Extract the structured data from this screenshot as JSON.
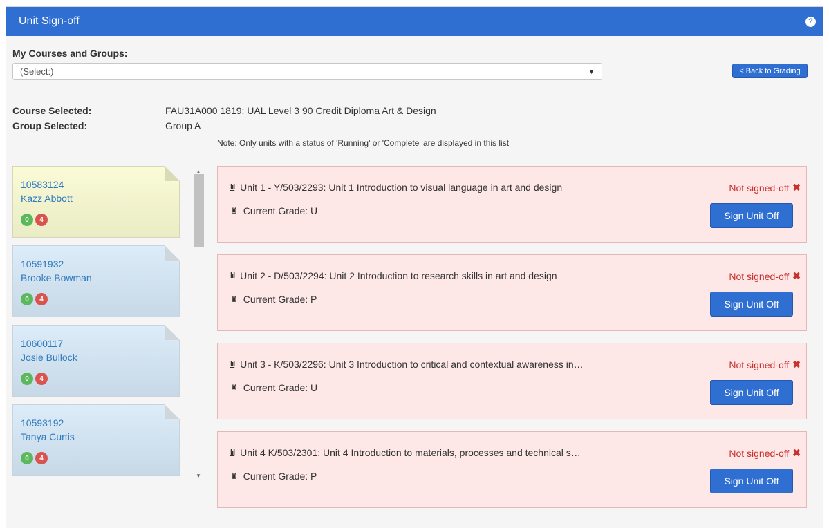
{
  "header": {
    "title": "Unit Sign-off",
    "help_icon": "?"
  },
  "courses": {
    "label": "My Courses and Groups:",
    "select_value": "(Select:)",
    "back_button": "< Back to Grading"
  },
  "selection": {
    "course_label": "Course Selected:",
    "course_value": "FAU31A000 1819: UAL Level 3 90 Credit Diploma Art & Design",
    "group_label": "Group Selected:",
    "group_value": "Group A"
  },
  "note": "Note: Only units with a status of 'Running' or 'Complete' are displayed in this list",
  "students": [
    {
      "id": "10583124",
      "name": "Kazz Abbott",
      "green": "0",
      "red": "4",
      "active": true
    },
    {
      "id": "10591932",
      "name": "Brooke Bowman",
      "green": "0",
      "red": "4",
      "active": false
    },
    {
      "id": "10600117",
      "name": "Josie Bullock",
      "green": "0",
      "red": "4",
      "active": false
    },
    {
      "id": "10593192",
      "name": "Tanya Curtis",
      "green": "0",
      "red": "4",
      "active": false
    }
  ],
  "units": [
    {
      "title": "Unit 1 - Y/503/2293: Unit 1 Introduction to visual language in art and design",
      "grade": "Current Grade: U",
      "status": "Not signed-off",
      "button": "Sign Unit Off"
    },
    {
      "title": "Unit 2 - D/503/2294: Unit 2 Introduction to research skills in art and design",
      "grade": "Current Grade: P",
      "status": "Not signed-off",
      "button": "Sign Unit Off"
    },
    {
      "title": "Unit 3 - K/503/2296: Unit 3 Introduction to critical and contextual awareness in…",
      "grade": "Current Grade: U",
      "status": "Not signed-off",
      "button": "Sign Unit Off"
    },
    {
      "title": "Unit 4 K/503/2301: Unit 4 Introduction to materials, processes and technical s…",
      "grade": "Current Grade: P",
      "status": "Not signed-off",
      "button": "Sign Unit Off"
    }
  ],
  "colors": {
    "header": "#2f6fd1",
    "link": "#2f7bbf",
    "status": "#c9302c",
    "unit_bg": "#fde7e7"
  }
}
